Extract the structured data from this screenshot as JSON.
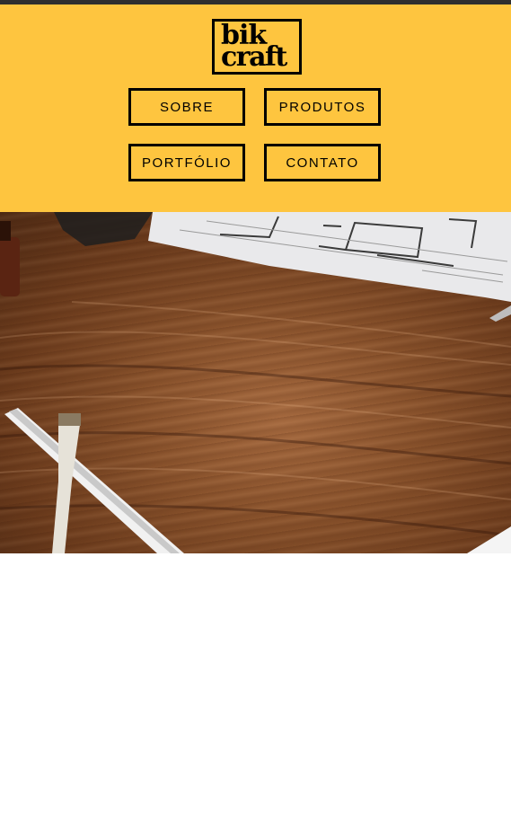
{
  "brand": {
    "logo_line1": "bik",
    "logo_line2": "craft"
  },
  "nav": {
    "items": [
      {
        "label": "SOBRE"
      },
      {
        "label": "PRODUTOS"
      },
      {
        "label": "PORTFÓLIO"
      },
      {
        "label": "CONTATO"
      }
    ]
  },
  "colors": {
    "header_background": "#fec53f",
    "top_bar": "#2f2f2f",
    "border": "#000000"
  },
  "hero": {
    "image": "wooden-desk-with-blueprints-and-tools-photo"
  }
}
